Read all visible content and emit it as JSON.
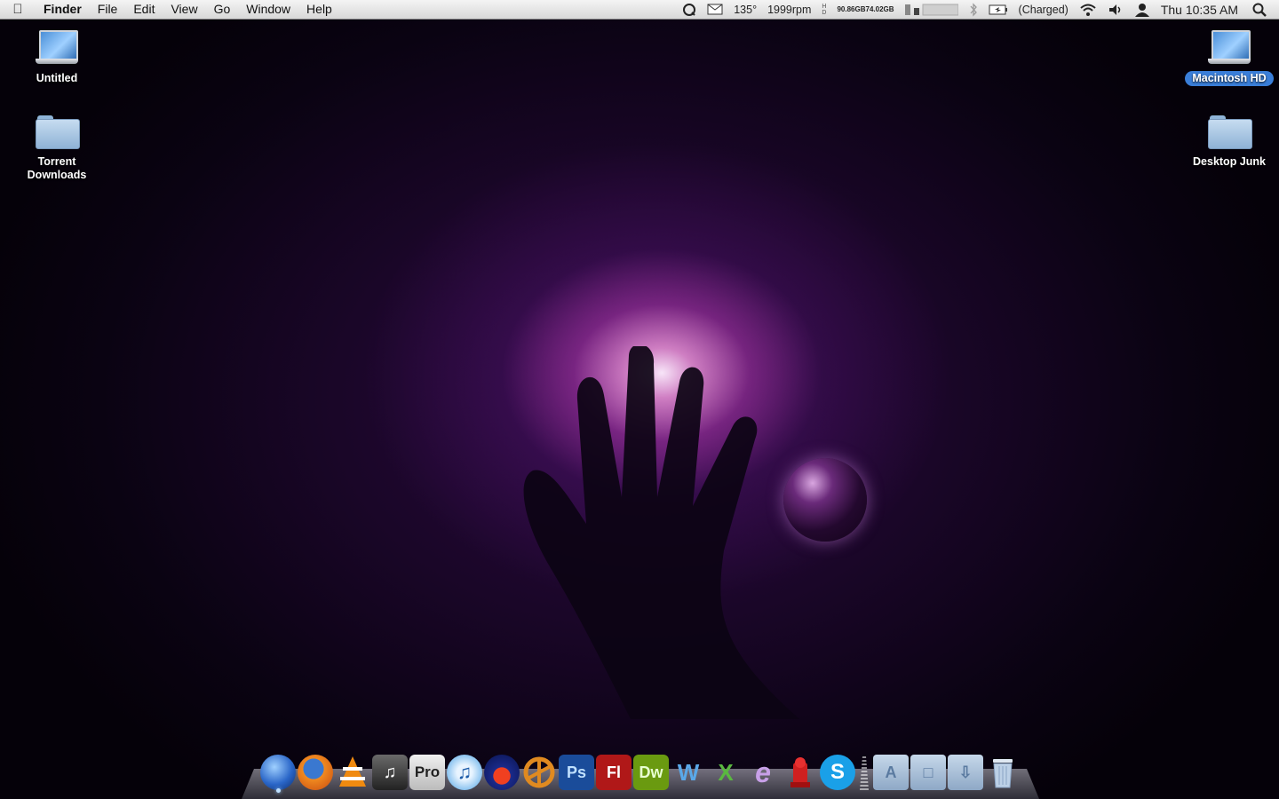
{
  "menubar": {
    "apple_icon": "apple-icon",
    "app_name": "Finder",
    "menus": [
      "File",
      "Edit",
      "View",
      "Go",
      "Window",
      "Help"
    ],
    "status": {
      "temperature": "135°",
      "fan_speed": "1999rpm",
      "disk_free_1": "90.86GB",
      "disk_free_2": "74.02GB",
      "battery": "(Charged)",
      "clock": "Thu 10:35 AM"
    }
  },
  "desktop": {
    "icons": [
      {
        "label": "Untitled",
        "icon": "laptop-drive-icon"
      },
      {
        "label": "Torrent\nDownloads",
        "icon": "folder-icon"
      },
      {
        "label": "Macintosh HD",
        "icon": "laptop-drive-icon",
        "selected": true
      },
      {
        "label": "Desktop Junk",
        "icon": "folder-icon"
      }
    ]
  },
  "dock": {
    "apps": [
      "finder-icon",
      "firefox-icon",
      "vlc-icon",
      "itunes-alt-icon",
      "final-cut-pro-icon",
      "itunes-icon",
      "audacity-icon",
      "propellerhead-icon",
      "photoshop-icon",
      "flash-icon",
      "dreamweaver-icon",
      "word-icon",
      "excel-icon",
      "entourage-icon",
      "fire-alarm-icon",
      "skype-icon"
    ],
    "pro_label": "Pro",
    "ps_label": "Ps",
    "fl_label": "Fl",
    "dw_label": "Dw",
    "w_label": "W",
    "x_label": "X",
    "e_label": "e",
    "s_label": "S",
    "stacks": [
      "applications-stack-icon",
      "documents-stack-icon",
      "downloads-stack-icon",
      "trash-icon"
    ]
  }
}
